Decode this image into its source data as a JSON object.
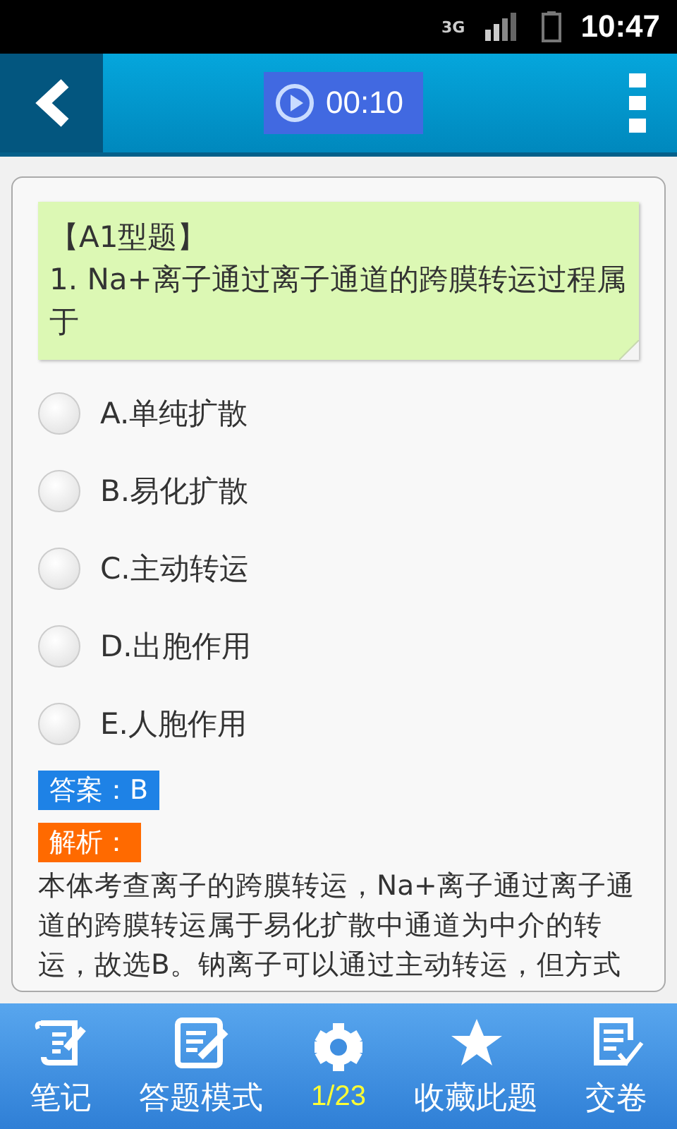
{
  "status_bar": {
    "network": "3G",
    "time": "10:47"
  },
  "header": {
    "timer": "00:10"
  },
  "question": {
    "type": "【A1型题】",
    "text": "1. Na+离子通过离子通道的跨膜转运过程属于"
  },
  "options": [
    {
      "label": "A.单纯扩散",
      "selected": false
    },
    {
      "label": "B.易化扩散",
      "selected": false
    },
    {
      "label": "C.主动转运",
      "selected": false
    },
    {
      "label": "D.出胞作用",
      "selected": false
    },
    {
      "label": "E.人胞作用",
      "selected": false
    }
  ],
  "answer": "答案：B",
  "analysis": {
    "label": "解析：",
    "text": "本体考查离子的跨膜转运，Na+离子通过离子通道的跨膜转运属于易化扩散中通道为中介的转运，故选B。钠离子可以通过主动转运，但方式"
  },
  "toolbar": [
    {
      "kind": "note",
      "label": "笔记"
    },
    {
      "kind": "mode",
      "label": "答题模式"
    },
    {
      "kind": "progress",
      "label": "1/23"
    },
    {
      "kind": "favorite",
      "label": "收藏此题"
    },
    {
      "kind": "submit",
      "label": "交卷"
    }
  ]
}
